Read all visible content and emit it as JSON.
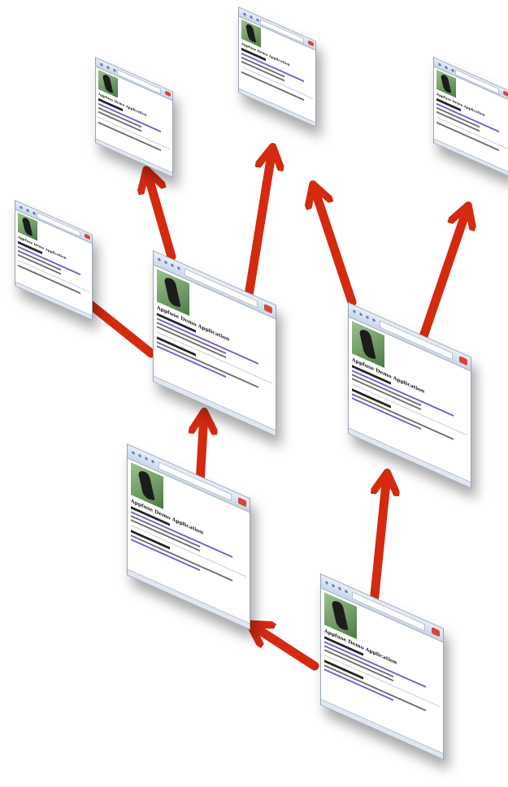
{
  "window_title": "Appfuse Demo Application",
  "arrow_color": "#d32a10",
  "windows": [
    "window-a",
    "window-b",
    "window-c",
    "window-d",
    "window-e",
    "window-f",
    "window-g",
    "window-h",
    "window-i"
  ]
}
